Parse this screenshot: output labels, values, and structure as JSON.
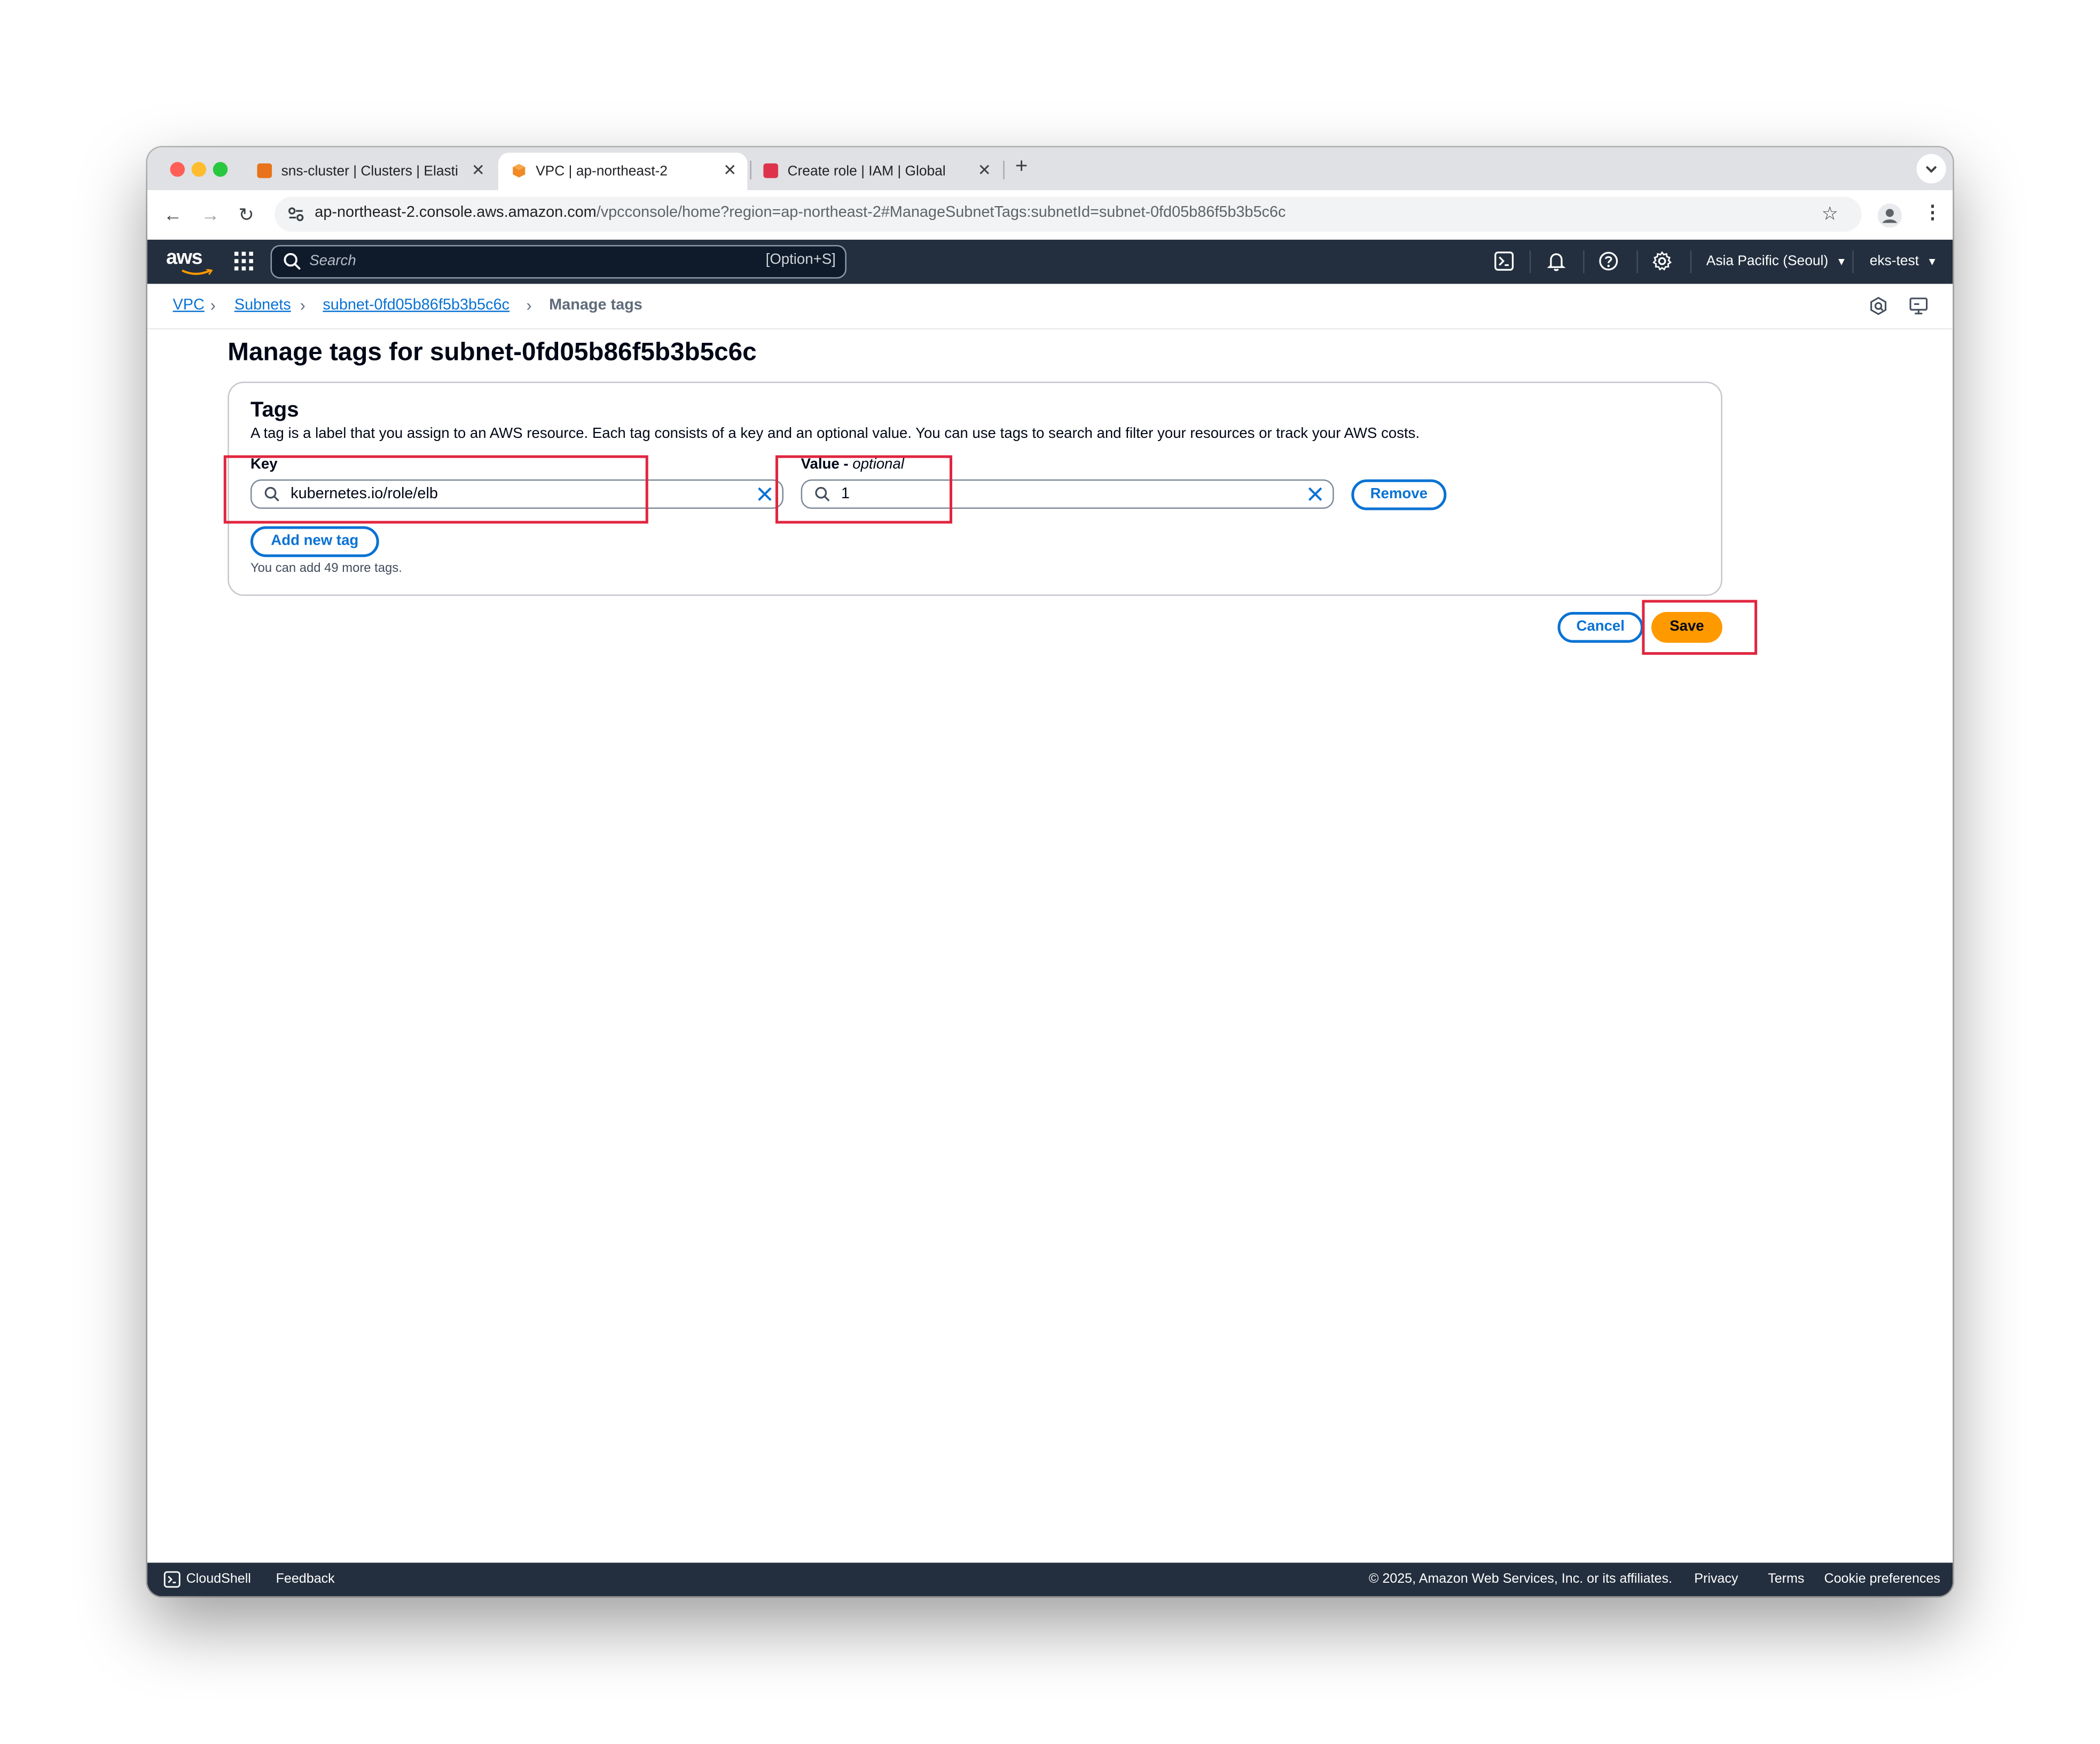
{
  "browser": {
    "tabs": [
      {
        "title": "sns-cluster | Clusters | Elastic",
        "active": false,
        "favicon_color": "#e8731a"
      },
      {
        "title": "VPC | ap-northeast-2",
        "active": true,
        "favicon_color": "#f08a24"
      },
      {
        "title": "Create role | IAM | Global",
        "active": false,
        "favicon_color": "#dd344c"
      }
    ],
    "new_tab_label": "+",
    "url_host": "ap-northeast-2.console.aws.amazon.com",
    "url_rest": "/vpcconsole/home?region=ap-northeast-2#ManageSubnetTags:subnetId=subnet-0fd05b86f5b3b5c6c"
  },
  "aws_header": {
    "logo_text": "aws",
    "search_placeholder": "Search",
    "search_shortcut": "[Option+S]",
    "region": "Asia Pacific (Seoul)",
    "account": "eks-test"
  },
  "breadcrumb": [
    {
      "label": "VPC",
      "link": true
    },
    {
      "label": "Subnets",
      "link": true
    },
    {
      "label": "subnet-0fd05b86f5b3b5c6c",
      "link": true
    },
    {
      "label": "Manage tags",
      "link": false
    }
  ],
  "page": {
    "title": "Manage tags for subnet-0fd05b86f5b3b5c6c",
    "tags_card": {
      "heading": "Tags",
      "description": "A tag is a label that you assign to an AWS resource. Each tag consists of a key and an optional value. You can use tags to search and filter your resources or track your AWS costs.",
      "key_label": "Key",
      "value_label": "Value -",
      "value_label_optional": "optional",
      "rows": [
        {
          "key": "kubernetes.io/role/elb",
          "value": "1"
        }
      ],
      "remove_label": "Remove",
      "add_label": "Add new tag",
      "remaining_hint": "You can add 49 more tags."
    },
    "cancel_label": "Cancel",
    "save_label": "Save"
  },
  "footer": {
    "cloudshell": "CloudShell",
    "feedback": "Feedback",
    "copyright": "© 2025, Amazon Web Services, Inc. or its affiliates.",
    "privacy": "Privacy",
    "terms": "Terms",
    "cookies": "Cookie preferences"
  },
  "colors": {
    "aws_dark": "#232f3e",
    "link_blue": "#0972d3",
    "primary_orange": "#ff9900",
    "annotation_red": "#e0253f"
  }
}
